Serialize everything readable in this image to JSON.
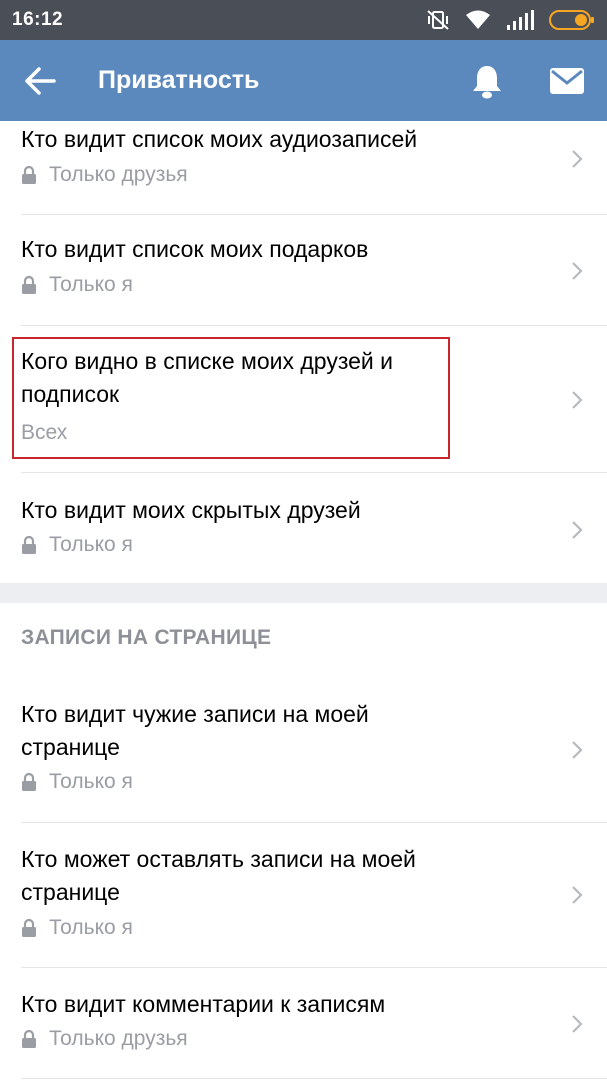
{
  "status_bar": {
    "time": "16:12"
  },
  "app_bar": {
    "title": "Приватность",
    "icons": [
      "back-arrow-icon",
      "bell-icon",
      "mail-icon"
    ]
  },
  "sections": {
    "posts_header": "ЗАПИСИ НА СТРАНИЦЕ"
  },
  "rows": [
    {
      "title": "Кто видит список моих аудиозаписей",
      "value": "Только друзья",
      "locked": true
    },
    {
      "title": "Кто видит список моих подарков",
      "value": "Только я",
      "locked": true
    },
    {
      "title": "Кого видно в списке моих друзей и подписок",
      "value": "Всех",
      "locked": false
    },
    {
      "title": "Кто видит моих скрытых друзей",
      "value": "Только я",
      "locked": true
    },
    {
      "title": "Кто видит чужие записи на моей странице",
      "value": "Только я",
      "locked": true
    },
    {
      "title": "Кто может оставлять записи на моей странице",
      "value": "Только я",
      "locked": true
    },
    {
      "title": "Кто видит комментарии к записям",
      "value": "Только друзья",
      "locked": true
    }
  ],
  "colors": {
    "status_bar": "#4a4e57",
    "app_bar": "#5b88bd",
    "secondary_text": "#9a9ea4",
    "highlight": "#c9252c",
    "battery": "#f5a623"
  }
}
